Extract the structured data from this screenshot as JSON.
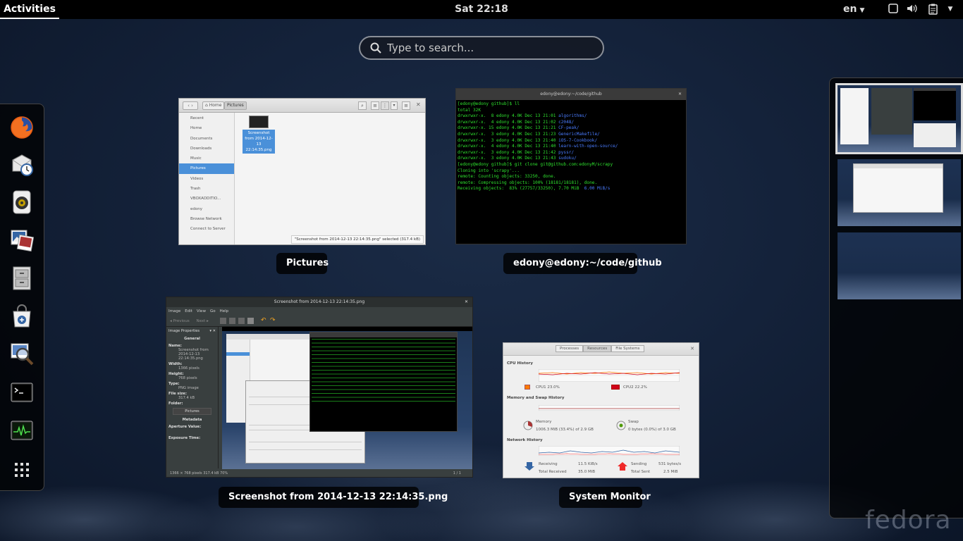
{
  "topbar": {
    "activities_label": "Activities",
    "clock": "Sat 22:18",
    "language": "en",
    "icons": [
      "window-icon",
      "volume-icon",
      "clipboard-icon"
    ]
  },
  "search": {
    "placeholder": "Type to search..."
  },
  "dash": {
    "apps": [
      "firefox-icon",
      "evolution-icon",
      "rhythmbox-icon",
      "shotwell-icon",
      "files-icon",
      "software-icon",
      "image-viewer-icon",
      "terminal-icon",
      "system-monitor-icon",
      "show-apps-icon"
    ]
  },
  "windows": [
    {
      "label": "Pictures"
    },
    {
      "label": "edony@edony:~/code/github"
    },
    {
      "label": "Screenshot from 2014-12-13 22:14:35.png"
    },
    {
      "label": "System Monitor"
    }
  ],
  "nautilus": {
    "breadcrumbs": [
      "Home",
      "Pictures"
    ],
    "sidebar": [
      "Recent",
      "Home",
      "Documents",
      "Downloads",
      "Music",
      "Pictures",
      "Videos",
      "Trash",
      "VBOXADDITIO...",
      "edony",
      "Browse Network",
      "Connect to Server"
    ],
    "file_name": "Screenshot from 2014-12-13 22:14:35.png",
    "status": "\"Screenshot from 2014-12-13 22:14:35.png\" selected (317.4 kB)"
  },
  "terminal": {
    "title": "edony@edony:~/code/github",
    "lines": [
      "[edony@edony github]$ ll",
      "total 32K",
      "drwxrwxr-x.  8 edony 4.0K Dec 13 21:01 |algorithms/",
      "drwxrwxr-x.  4 edony 4.0K Dec 13 21:02 |c2048/",
      "drwxrwxr-x. 15 edony 4.0K Dec 13 21:21 |CF-peak/",
      "drwxrwxr-x.  3 edony 4.0K Dec 13 21:23 |GenericMakefile/",
      "drwxrwxr-x.  3 edony 4.0K Dec 13 21:40 |iOS-7-Cookbook/",
      "drwxrwxr-x.  4 edony 4.0K Dec 13 21:40 |learn-with-open-source/",
      "drwxrwxr-x.  3 edony 4.0K Dec 13 21:42 |pyssr/",
      "drwxrwxr-x.  3 edony 4.0K Dec 13 21:43 |sudoku/",
      "[edony@edony github]$ git clone git@github.com:edonyM/scrapy",
      "Cloning into 'scrapy'...",
      "remote: Counting objects: 33250, done.",
      "remote: Compressing objects: 100% (18181/18181), done.",
      "Receiving objects:  83% (27757/33250), 7.70 MiB | 6.00 MiB/s"
    ]
  },
  "image_viewer": {
    "title": "Screenshot from 2014-12-13 22:14:35.png",
    "menu": [
      "Image",
      "Edit",
      "View",
      "Go",
      "Help"
    ],
    "prev": "Previous",
    "next": "Next",
    "panel_title": "Image Properties",
    "general": "General",
    "props": [
      {
        "k": "Name:",
        "v": "Screenshot from 2014-12-13 22:14:35.png"
      },
      {
        "k": "Width:",
        "v": "1366 pixels"
      },
      {
        "k": "Height:",
        "v": "768 pixels"
      },
      {
        "k": "Type:",
        "v": "PNG image"
      },
      {
        "k": "File size:",
        "v": "317.4 kB"
      },
      {
        "k": "Folder:",
        "v": ""
      }
    ],
    "folder_button": "Pictures",
    "metadata": "Metadata",
    "aperture": "Aperture Value:",
    "exposure": "Exposure Time:",
    "status": "1366 × 768 pixels  317.4 kB   70%",
    "page": "1 / 1"
  },
  "system_monitor": {
    "tabs": [
      "Processes",
      "Resources",
      "File Systems"
    ],
    "cpu_title": "CPU History",
    "cpu1": "CPU1  23.0%",
    "cpu2": "CPU2  22.2%",
    "mem_title": "Memory and Swap History",
    "memory_label": "Memory",
    "memory_value": "1006.3 MiB (33.4%) of 2.9 GB",
    "swap_label": "Swap",
    "swap_value": "0 bytes (0.0%) of 3.0 GB",
    "net_title": "Network History",
    "receiving": "Receiving",
    "receiving_val": "11.5 KiB/s",
    "total_received": "Total Received",
    "total_received_val": "35.0 MiB",
    "sending": "Sending",
    "sending_val": "531 bytes/s",
    "total_sent": "Total Sent",
    "total_sent_val": "2.5 MiB",
    "colors": {
      "cpu1": "#ff7b00",
      "cpu2": "#d0021b",
      "receive": "#3465a4",
      "send": "#ef2929"
    }
  },
  "watermark": "fedora"
}
